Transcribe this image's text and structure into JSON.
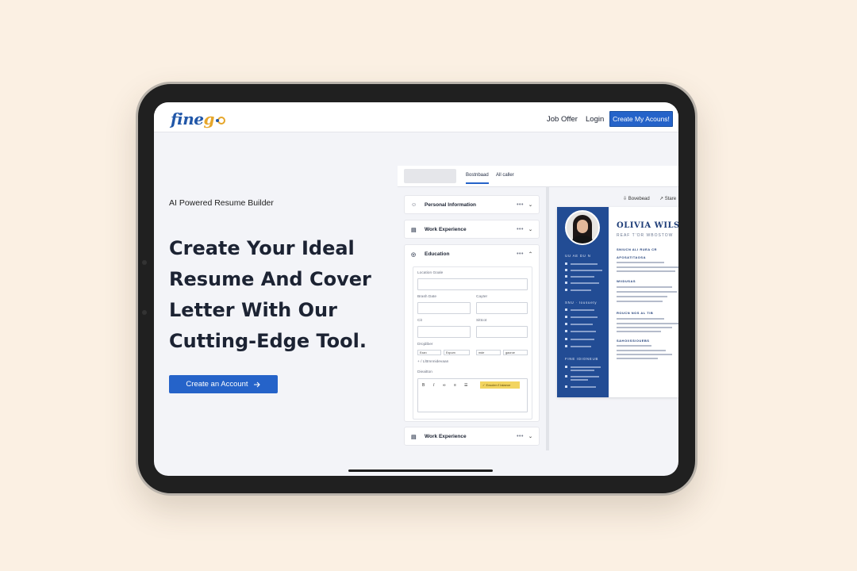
{
  "colors": {
    "accent": "#2563c9",
    "background": "#fbf0e3",
    "resume_sidebar": "#224c94"
  },
  "header": {
    "logo_main": "fine",
    "logo_accent": "g",
    "nav": {
      "job_offer": "Job Offer",
      "login": "Login"
    },
    "cta_label": "Create My Acouns!"
  },
  "hero": {
    "kicker": "AI Powered Resume Builder",
    "headline_lines": [
      "Create Your Ideal",
      "Resume And Cover",
      "Letter With Our",
      "Cutting-Edge Tool."
    ],
    "cta_label": "Create an Account",
    "cta_icon": "arrow-right-icon"
  },
  "editor": {
    "tabs": [
      "Bostnbaad",
      "All caller"
    ],
    "sections": {
      "personal": {
        "label": "Personal Information",
        "icon": "user-icon"
      },
      "work1": {
        "label": "Work Experience",
        "icon": "document-icon"
      },
      "education": {
        "label": "Education",
        "icon": "graduation-icon"
      },
      "work2": {
        "label": "Work Experience",
        "icon": "document-icon"
      }
    },
    "form": {
      "location_label": "Location Goale",
      "start_label": "Brash Date",
      "career_label": "Cayter",
      "cit_label": "Cit",
      "school_label": "Sittcot",
      "discipline_label": "Drojdiber",
      "selects": [
        "Exan",
        "Expum",
        "mde",
        "gaoroe"
      ],
      "link_label": "+ / Llttmnnidevaan",
      "description_label": "Dieaitton",
      "toolbar": [
        "B",
        "I",
        "∞",
        "≡",
        "☰"
      ],
      "chip_label": "✓ Exsolen ℓ Ialaeoe"
    }
  },
  "preview": {
    "tools": {
      "download": "Bovebead",
      "share": "Stare"
    },
    "name": "OLIVIA WILSON",
    "subtitle": "REAF T'OR WBOSTOW",
    "sidebar_headings": [
      "UU AE DU N",
      "SNU · Iousuety",
      "FINE IDIONEUB"
    ],
    "main_headings": [
      "SNIUCN ALI RUEA CR",
      "AFOSATITAOSA",
      "WIIDUSAS",
      "ROUCN NOS AL TIB",
      "SAHOIISSIOUEBS"
    ]
  }
}
